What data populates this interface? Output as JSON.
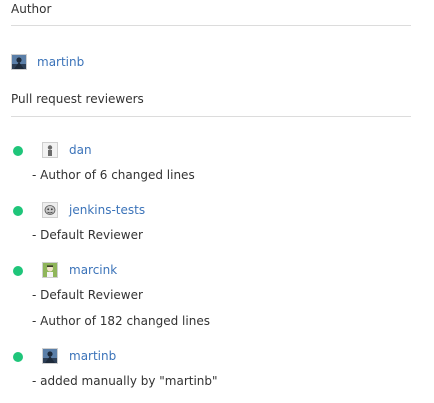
{
  "author_section": {
    "title": "Author",
    "user": {
      "name": "martinb",
      "avatar_icon": "martinb-avatar-icon"
    }
  },
  "reviewers_section": {
    "title": "Pull request reviewers",
    "status_color": "#1fc57a",
    "reviewers": [
      {
        "name": "dan",
        "reasons": [
          "- Author of 6 changed lines"
        ]
      },
      {
        "name": "jenkins-tests",
        "reasons": [
          "- Default Reviewer"
        ]
      },
      {
        "name": "marcink",
        "reasons": [
          "- Default Reviewer",
          "- Author of 182 changed lines"
        ]
      },
      {
        "name": "martinb",
        "reasons": [
          "- added manually by \"martinb\""
        ]
      }
    ]
  },
  "colors": {
    "link": "#3b73b9",
    "text": "#323232",
    "divider": "#dcdcdc",
    "status_approved": "#1fc57a"
  }
}
